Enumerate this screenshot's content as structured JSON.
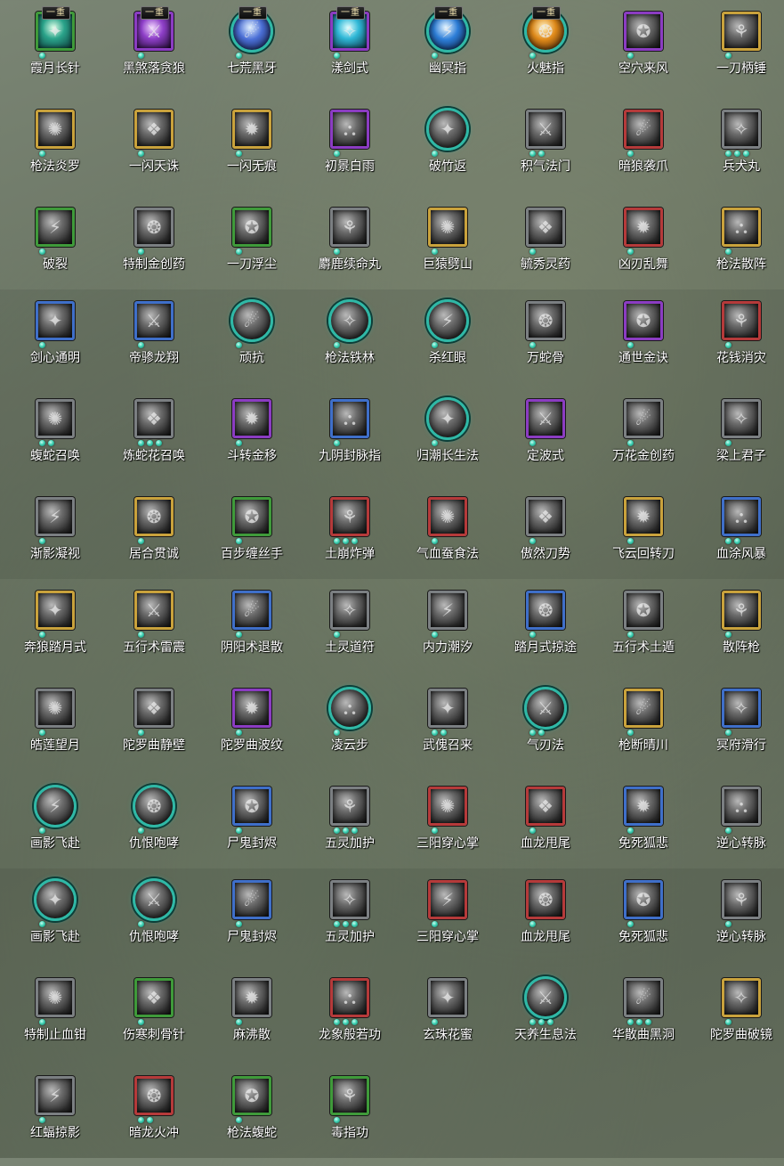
{
  "skills": [
    {
      "name": "霞月长针",
      "frame": "green",
      "dots": 1,
      "badge": "一重",
      "art": "c1"
    },
    {
      "name": "黑煞落贪狼",
      "frame": "purple",
      "dots": 1,
      "badge": "一重",
      "art": "c2"
    },
    {
      "name": "七荒黑牙",
      "frame": "teal",
      "dots": 1,
      "badge": "一重",
      "art": "c3"
    },
    {
      "name": "漾剑式",
      "frame": "purple",
      "dots": 1,
      "badge": "一重",
      "art": "c4"
    },
    {
      "name": "幽冥指",
      "frame": "teal",
      "dots": 1,
      "badge": "一重",
      "art": "c5"
    },
    {
      "name": "火魅指",
      "frame": "teal",
      "dots": 1,
      "badge": "一重",
      "art": "c6"
    },
    {
      "name": "空穴来风",
      "frame": "purple",
      "dots": 1
    },
    {
      "name": "一刀柄锤",
      "frame": "gold",
      "dots": 1
    },
    {
      "name": "枪法炎罗",
      "frame": "gold",
      "dots": 1
    },
    {
      "name": "一闪天诛",
      "frame": "gold",
      "dots": 1
    },
    {
      "name": "一闪无痕",
      "frame": "gold",
      "dots": 1
    },
    {
      "name": "初景白雨",
      "frame": "purple",
      "dots": 1
    },
    {
      "name": "破竹返",
      "frame": "teal",
      "dots": 1
    },
    {
      "name": "积气法门",
      "frame": "gray",
      "dots": 2
    },
    {
      "name": "暗狼袭爪",
      "frame": "red",
      "dots": 1
    },
    {
      "name": "兵犬丸",
      "frame": "gray",
      "dots": 3
    },
    {
      "name": "破裂",
      "frame": "green",
      "dots": 1
    },
    {
      "name": "特制金创药",
      "frame": "gray",
      "dots": 1
    },
    {
      "name": "一刀浮尘",
      "frame": "green",
      "dots": 1
    },
    {
      "name": "麝鹿续命丸",
      "frame": "gray",
      "dots": 1
    },
    {
      "name": "巨猿劈山",
      "frame": "gold",
      "dots": 1
    },
    {
      "name": "毓秀灵药",
      "frame": "gray",
      "dots": 1
    },
    {
      "name": "凶刃乱舞",
      "frame": "red",
      "dots": 1
    },
    {
      "name": "枪法散阵",
      "frame": "gold",
      "dots": 1
    },
    {
      "name": "剑心通明",
      "frame": "blue",
      "dots": 1
    },
    {
      "name": "帝骖龙翔",
      "frame": "blue",
      "dots": 1
    },
    {
      "name": "顽抗",
      "frame": "teal",
      "dots": 1
    },
    {
      "name": "枪法铁林",
      "frame": "teal",
      "dots": 1
    },
    {
      "name": "杀红眼",
      "frame": "teal",
      "dots": 1
    },
    {
      "name": "万蛇骨",
      "frame": "gray",
      "dots": 1
    },
    {
      "name": "通世金诀",
      "frame": "purple",
      "dots": 1
    },
    {
      "name": "花钱消灾",
      "frame": "red",
      "dots": 1
    },
    {
      "name": "蝮蛇召唤",
      "frame": "gray",
      "dots": 2
    },
    {
      "name": "炼蛇花召唤",
      "frame": "gray",
      "dots": 3
    },
    {
      "name": "斗转金移",
      "frame": "purple",
      "dots": 1
    },
    {
      "name": "九阴封脉指",
      "frame": "blue",
      "dots": 1
    },
    {
      "name": "归潮长生法",
      "frame": "teal",
      "dots": 1
    },
    {
      "name": "定波式",
      "frame": "purple",
      "dots": 1
    },
    {
      "name": "万花金创药",
      "frame": "gray",
      "dots": 1
    },
    {
      "name": "梁上君子",
      "frame": "gray",
      "dots": 1
    },
    {
      "name": "渐影凝视",
      "frame": "gray",
      "dots": 1
    },
    {
      "name": "居合贯诚",
      "frame": "gold",
      "dots": 1
    },
    {
      "name": "百步缠丝手",
      "frame": "green",
      "dots": 1
    },
    {
      "name": "土崩炸弹",
      "frame": "red",
      "dots": 3
    },
    {
      "name": "气血蚕食法",
      "frame": "red",
      "dots": 1
    },
    {
      "name": "傲然刀势",
      "frame": "gray",
      "dots": 1
    },
    {
      "name": "飞云回转刀",
      "frame": "gold",
      "dots": 1
    },
    {
      "name": "血涂风暴",
      "frame": "blue",
      "dots": 2
    },
    {
      "name": "奔狼踏月式",
      "frame": "gold",
      "dots": 1
    },
    {
      "name": "五行术雷震",
      "frame": "gold",
      "dots": 1
    },
    {
      "name": "阴阳术退散",
      "frame": "blue",
      "dots": 1
    },
    {
      "name": "土灵道符",
      "frame": "gray",
      "dots": 1
    },
    {
      "name": "内力潮汐",
      "frame": "gray",
      "dots": 1
    },
    {
      "name": "踏月式掠途",
      "frame": "blue",
      "dots": 1
    },
    {
      "name": "五行术土遁",
      "frame": "gray",
      "dots": 1
    },
    {
      "name": "散阵枪",
      "frame": "gold",
      "dots": 1
    },
    {
      "name": "皓莲望月",
      "frame": "gray",
      "dots": 1
    },
    {
      "name": "陀罗曲静壁",
      "frame": "gray",
      "dots": 1
    },
    {
      "name": "陀罗曲波纹",
      "frame": "purple",
      "dots": 1
    },
    {
      "name": "凌云步",
      "frame": "teal",
      "dots": 1
    },
    {
      "name": "武傀召来",
      "frame": "gray",
      "dots": 2
    },
    {
      "name": "气刃法",
      "frame": "teal",
      "dots": 2
    },
    {
      "name": "枪断晴川",
      "frame": "gold",
      "dots": 1
    },
    {
      "name": "冥府滑行",
      "frame": "blue",
      "dots": 1
    },
    {
      "name": "画影飞赴",
      "frame": "teal",
      "dots": 1
    },
    {
      "name": "仇恨咆哮",
      "frame": "teal",
      "dots": 1
    },
    {
      "name": "尸鬼封烬",
      "frame": "blue",
      "dots": 1
    },
    {
      "name": "五灵加护",
      "frame": "gray",
      "dots": 3
    },
    {
      "name": "三阳穿心掌",
      "frame": "red",
      "dots": 1
    },
    {
      "name": "血龙甩尾",
      "frame": "red",
      "dots": 1
    },
    {
      "name": "免死狐悲",
      "frame": "blue",
      "dots": 1
    },
    {
      "name": "逆心转脉",
      "frame": "gray",
      "dots": 1
    },
    {
      "name": "画影飞赴",
      "frame": "teal",
      "dots": 1
    },
    {
      "name": "仇恨咆哮",
      "frame": "teal",
      "dots": 1
    },
    {
      "name": "尸鬼封烬",
      "frame": "blue",
      "dots": 1
    },
    {
      "name": "五灵加护",
      "frame": "gray",
      "dots": 3
    },
    {
      "name": "三阳穿心掌",
      "frame": "red",
      "dots": 1
    },
    {
      "name": "血龙甩尾",
      "frame": "red",
      "dots": 1
    },
    {
      "name": "免死狐悲",
      "frame": "blue",
      "dots": 1
    },
    {
      "name": "逆心转脉",
      "frame": "gray",
      "dots": 1
    },
    {
      "name": "特制止血钳",
      "frame": "gray",
      "dots": 1
    },
    {
      "name": "伤寒刺骨针",
      "frame": "green",
      "dots": 1
    },
    {
      "name": "麻沸散",
      "frame": "gray",
      "dots": 1
    },
    {
      "name": "龙象般若功",
      "frame": "red",
      "dots": 3
    },
    {
      "name": "玄珠花蜜",
      "frame": "gray",
      "dots": 1
    },
    {
      "name": "天养生息法",
      "frame": "teal",
      "dots": 3
    },
    {
      "name": "华散曲黑洞",
      "frame": "gray",
      "dots": 3
    },
    {
      "name": "陀罗曲破镜",
      "frame": "gold",
      "dots": 1
    },
    {
      "name": "红蝠掠影",
      "frame": "gray",
      "dots": 1
    },
    {
      "name": "暗龙火冲",
      "frame": "red",
      "dots": 2
    },
    {
      "name": "枪法蝮蛇",
      "frame": "green",
      "dots": 1
    },
    {
      "name": "毒指功",
      "frame": "green",
      "dots": 1
    }
  ]
}
